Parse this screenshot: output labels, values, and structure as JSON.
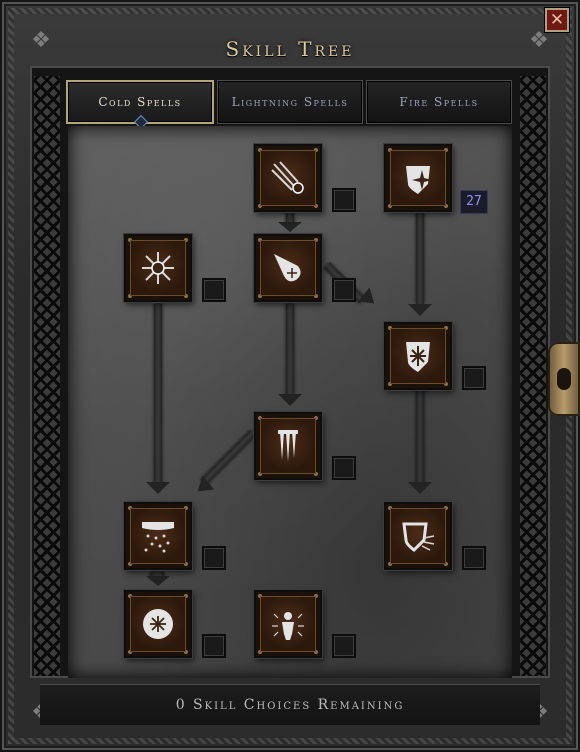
{
  "window": {
    "title": "Skill Tree",
    "close_glyph": "✕"
  },
  "tabs": [
    {
      "label": "Cold Spells",
      "active": true
    },
    {
      "label": "Lightning Spells",
      "active": false
    },
    {
      "label": "Fire Spells",
      "active": false
    }
  ],
  "skills": [
    {
      "id": "ice-shards",
      "icon": "ice-shards-icon"
    },
    {
      "id": "frost-shield",
      "icon": "frost-shield-icon"
    },
    {
      "id": "frost-nova",
      "icon": "frost-nova-icon"
    },
    {
      "id": "ice-bolt",
      "icon": "ice-bolt-icon"
    },
    {
      "id": "snowflake-shield",
      "icon": "snowflake-shield-icon"
    },
    {
      "id": "icicles",
      "icon": "icicles-icon"
    },
    {
      "id": "blizzard",
      "icon": "blizzard-icon"
    },
    {
      "id": "ice-barrier",
      "icon": "ice-barrier-icon"
    },
    {
      "id": "frozen-orb",
      "icon": "frozen-orb-icon"
    },
    {
      "id": "ice-armor",
      "icon": "ice-armor-icon"
    }
  ],
  "skill_points": {
    "frost-shield": "27"
  },
  "footer": {
    "text": "0 Skill Choices Remaining"
  },
  "colors": {
    "accent": "#d9c89a",
    "points": "#8f8fff",
    "close": "#6e1a12"
  }
}
